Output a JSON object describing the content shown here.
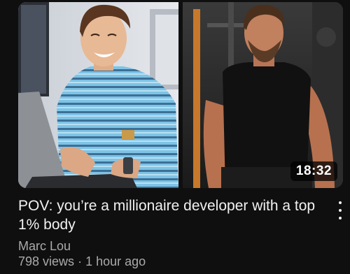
{
  "video": {
    "title": "POV: you’re a millionaire developer with a top 1% body",
    "duration": "18:32",
    "channel": "Marc Lou",
    "views": "798 views",
    "separator": "·",
    "age": "1 hour ago"
  },
  "icons": {
    "menu": "more-vert-icon"
  },
  "colors": {
    "background": "#0f0f0f",
    "title_text": "#f1f1f1",
    "meta_text": "#aaaaaa"
  }
}
